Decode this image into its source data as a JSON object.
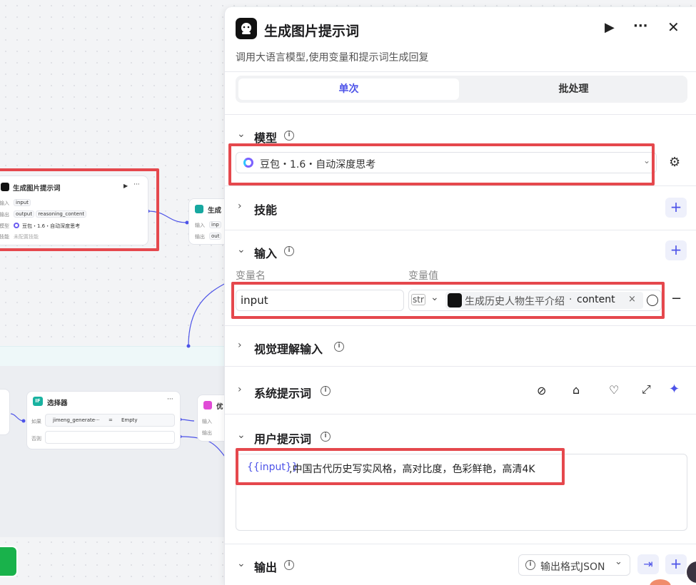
{
  "canvas": {
    "node_image_prompt": {
      "title": "生成图片提示词",
      "input_label": "输入",
      "input_var": "input",
      "output_label": "输出",
      "output_var1": "output",
      "output_var2": "reasoning_content",
      "model_label": "模型",
      "model_value": "豆包・1.6・自动深度思考",
      "skill_label": "技能",
      "skill_value": "未配置技能"
    },
    "node_generate": {
      "title": "生成",
      "input_label": "输入",
      "input_var": "inp",
      "output_label": "输出",
      "output_var": "out"
    },
    "node_selector": {
      "title": "选择器",
      "badge": "IF",
      "if_label": "如果",
      "var": "jimeng_generate···",
      "op": "=",
      "value": "Empty",
      "else_label": "否则"
    },
    "node_optimize": {
      "title": "优",
      "input_label": "输入",
      "output_label": "输出"
    }
  },
  "panel": {
    "title": "生成图片提示词",
    "description": "调用大语言模型,使用变量和提示词生成回复",
    "tabs": [
      {
        "label": "单次"
      },
      {
        "label": "批处理"
      }
    ],
    "model": {
      "section": "模型",
      "value": "豆包・1.6・自动深度思考"
    },
    "skills": {
      "section": "技能"
    },
    "inputs": {
      "section": "输入",
      "col_name": "变量名",
      "col_value": "变量值",
      "row": {
        "name": "input",
        "type": "str",
        "source_node": "生成历史人物生平介绍",
        "source_sep": "·",
        "source_field": "content"
      }
    },
    "vision": {
      "section": "视觉理解输入"
    },
    "system_prompt": {
      "section": "系统提示词"
    },
    "user_prompt": {
      "section": "用户提示词",
      "var_token": "{{input}}",
      "text": ",中国古代历史写实风格，高对比度，色彩鲜艳，高清4K"
    },
    "output": {
      "section": "输出",
      "format_label": "输出格式JSON"
    }
  },
  "colors": {
    "accent": "#4d53e8",
    "highlight": "#e5484d",
    "green": "#19b24b"
  }
}
